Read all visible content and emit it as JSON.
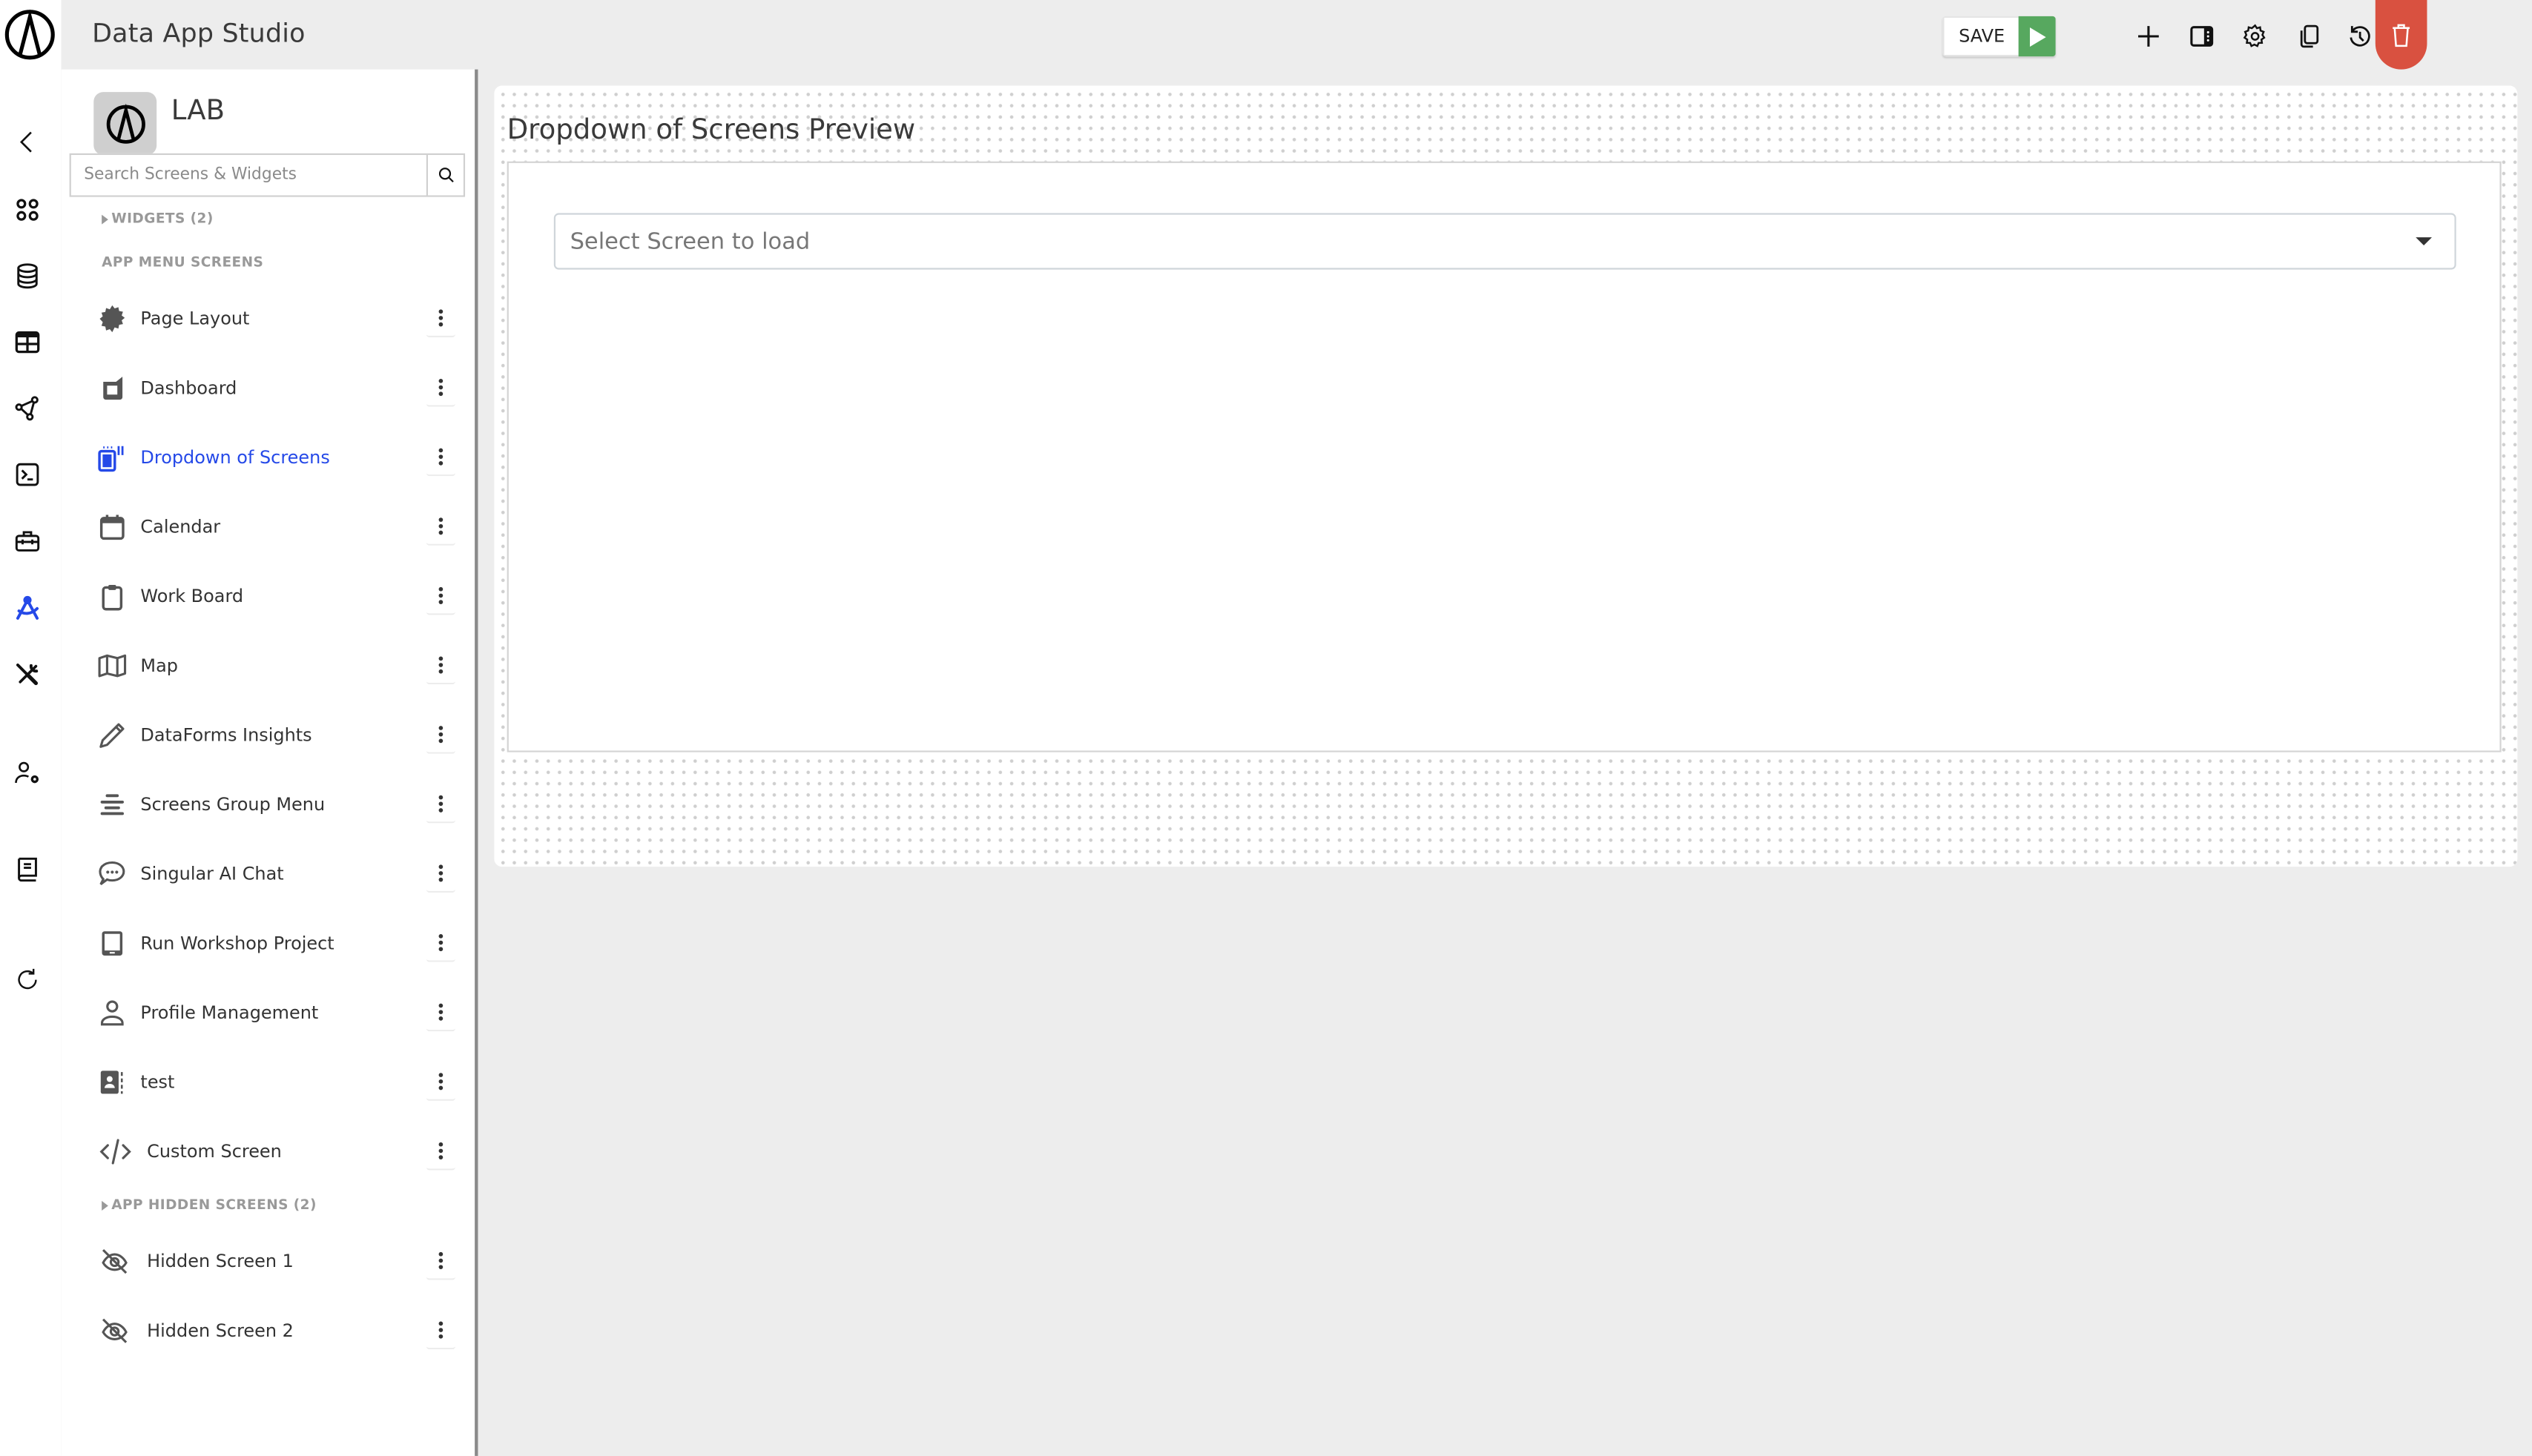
{
  "app": {
    "title": "Data App Studio"
  },
  "toolbar": {
    "save_label": "SAVE",
    "icons": [
      "play-icon",
      "plus-icon",
      "panel-icon",
      "gear-icon",
      "copy-icon",
      "history-icon",
      "branch-icon",
      "trash-icon"
    ]
  },
  "rail": {
    "items": [
      "back-icon",
      "apps-icon",
      "database-icon",
      "table-icon",
      "graph-icon",
      "terminal-icon",
      "toolbox-icon",
      "design-icon",
      "tools-icon",
      "user-settings-icon",
      "book-icon",
      "refresh-icon"
    ],
    "active": "design-icon",
    "accent_color": "#2549e8"
  },
  "panel": {
    "title": "LAB",
    "search_placeholder": "Search Screens & Widgets",
    "widgets_label": "WIDGETS (2)",
    "menu_screens_label": "APP MENU SCREENS",
    "menu_screens": [
      {
        "label": "Page Layout",
        "icon": "badge-icon"
      },
      {
        "label": "Dashboard",
        "icon": "dashboard-icon"
      },
      {
        "label": "Dropdown of Screens",
        "icon": "dropdown-screens-icon",
        "active": true
      },
      {
        "label": "Calendar",
        "icon": "calendar-icon"
      },
      {
        "label": "Work Board",
        "icon": "clipboard-icon"
      },
      {
        "label": "Map",
        "icon": "map-icon"
      },
      {
        "label": "DataForms Insights",
        "icon": "pencil-icon"
      },
      {
        "label": "Screens Group Menu",
        "icon": "menu-lines-icon"
      },
      {
        "label": "Singular AI Chat",
        "icon": "chat-icon"
      },
      {
        "label": "Run Workshop Project",
        "icon": "tablet-icon"
      },
      {
        "label": "Profile Management",
        "icon": "user-icon"
      },
      {
        "label": "test",
        "icon": "contact-book-icon"
      },
      {
        "label": "Custom Screen",
        "icon": "code-icon"
      }
    ],
    "hidden_screens_label": "APP HIDDEN SCREENS (2)",
    "hidden_screens": [
      {
        "label": "Hidden Screen 1",
        "icon": "eye-off-icon"
      },
      {
        "label": "Hidden Screen 2",
        "icon": "eye-off-icon"
      }
    ]
  },
  "canvas": {
    "preview_title": "Dropdown of Screens Preview",
    "select_placeholder": "Select Screen to load"
  },
  "colors": {
    "accent": "#2549e8",
    "save_play": "#57a85f",
    "delete": "#d95140"
  }
}
